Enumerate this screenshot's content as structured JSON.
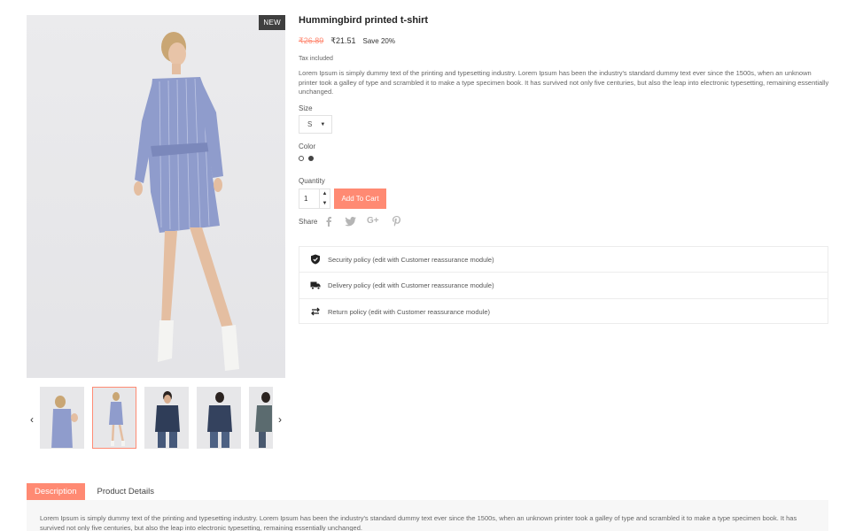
{
  "product": {
    "badge": "NEW",
    "title": "Hummingbird printed t-shirt",
    "old_price": "₹26.89",
    "new_price": "₹21.51",
    "save": "Save 20%",
    "tax": "Tax included",
    "description": "Lorem Ipsum is simply dummy text of the printing and typesetting industry. Lorem Ipsum has been the industry's standard dummy text ever since the 1500s, when an unknown printer took a galley of type and scrambled it to make a type specimen book. It has survived not only five centuries, but also the leap into electronic typesetting, remaining essentially unchanged."
  },
  "options": {
    "size_label": "Size",
    "size_value": "S",
    "color_label": "Color",
    "quantity_label": "Quantity",
    "quantity_value": "1",
    "add_to_cart": "Add To Cart",
    "share_label": "Share"
  },
  "reassurance": [
    {
      "icon": "shield-icon",
      "text": "Security policy (edit with Customer reassurance module)"
    },
    {
      "icon": "truck-icon",
      "text": "Delivery policy (edit with Customer reassurance module)"
    },
    {
      "icon": "exchange-icon",
      "text": "Return policy (edit with Customer reassurance module)"
    }
  ],
  "tabs": {
    "description": "Description",
    "details": "Product Details",
    "panel_text": "Lorem Ipsum is simply dummy text of the printing and typesetting industry. Lorem Ipsum has been the industry's standard dummy text ever since the 1500s, when an unknown printer took a galley of type and scrambled it to make a type specimen book. It has survived not only five centuries, but also the leap into electronic typesetting, remaining essentially unchanged."
  },
  "colors": {
    "accent": "#ff8a73",
    "badge": "#3f3f3f",
    "dress": "#8f9ccc"
  }
}
